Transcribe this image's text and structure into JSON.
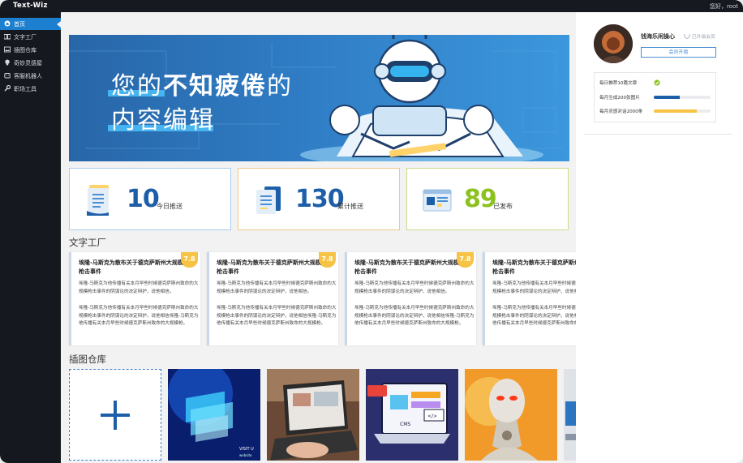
{
  "app": {
    "name": "Text-Wiz"
  },
  "topbar": {
    "greeting": "您好，root"
  },
  "sidebar": {
    "items": [
      {
        "label": "首页",
        "icon": "home-icon",
        "active": true
      },
      {
        "label": "文字工厂",
        "icon": "book-icon"
      },
      {
        "label": "插图仓库",
        "icon": "image-icon"
      },
      {
        "label": "奇妙灵感屋",
        "icon": "bulb-icon"
      },
      {
        "label": "客服机器人",
        "icon": "robot-icon"
      },
      {
        "label": "职场工具",
        "icon": "wrench-icon"
      }
    ]
  },
  "banner": {
    "line1_pre": "您的",
    "line1_bold": "不知疲倦",
    "line1_post": "的",
    "line2": "内容编辑"
  },
  "stats": [
    {
      "value": "10",
      "label": "今日推送",
      "color": "#1c5fa8",
      "icon": "document-icon"
    },
    {
      "value": "130",
      "label": "累计推送",
      "color": "#1c5fa8",
      "icon": "files-icon"
    },
    {
      "value": "89",
      "label": "已发布",
      "color": "#8cc21f",
      "icon": "browser-window-icon"
    }
  ],
  "text_factory": {
    "title": "文字工厂",
    "articles": [
      {
        "title": "埃隆-马斯克为散布关于德克萨斯州大规模枪击事件",
        "score": "7.8",
        "p1": "埃隆-马斯克为他传播有关本月早些时候德克萨斯州致命的大规模枪击事件的阴谋论的决定辩护，说他相信。",
        "p2": "埃隆-马斯克为他传播有关本月早些时候德克萨斯州致命的大规模枪击事件的阴谋论的决定辩护，说他相信埃隆-马斯克为他传播有关本月早些时候德克萨斯州致命的大规模枪。"
      },
      {
        "title": "埃隆-马斯克为散布关于德克萨斯州大规模枪击事件",
        "score": "7.8",
        "p1": "埃隆-马斯克为他传播有关本月早些时候德克萨斯州致命的大规模枪击事件的阴谋论的决定辩护，说他相信。",
        "p2": "埃隆-马斯克为他传播有关本月早些时候德克萨斯州致命的大规模枪击事件的阴谋论的决定辩护，说他相信埃隆-马斯克为他传播有关本月早些时候德克萨斯州致命的大规模枪。"
      },
      {
        "title": "埃隆-马斯克为散布关于德克萨斯州大规模枪击事件",
        "score": "7.8",
        "p1": "埃隆-马斯克为他传播有关本月早些时候德克萨斯州致命的大规模枪击事件的阴谋论的决定辩护，说他相信。",
        "p2": "埃隆-马斯克为他传播有关本月早些时候德克萨斯州致命的大规模枪击事件的阴谋论的决定辩护，说他相信埃隆-马斯克为他传播有关本月早些时候德克萨斯州致命的大规模枪。"
      },
      {
        "title": "埃隆-马斯克为散布关于德克萨斯州大规模枪击事件",
        "score": "",
        "p1": "埃隆-马斯克为他传播有关本月早些时候德克萨斯州致命的大规模枪击事件的阴谋论的决定辩护，说他相信。",
        "p2": "埃隆-马斯克为他传播有关本月早些时候德克萨斯州致命的大规模枪击事件的阴谋论的决定辩护，说他相信埃隆-马斯克为他传播有关本月早些时候德克萨斯州致命的大规模枪。"
      }
    ]
  },
  "gallery": {
    "title": "插图仓库",
    "add_icon": "plus-icon",
    "thumb1_caption": "VISIT U",
    "thumb1_sub": "website",
    "thumb3_cms": "CMS",
    "thumb3_code": "</>"
  },
  "profile": {
    "username": "钱海乐闲操心",
    "badge": "已升级会员",
    "upgrade_label": "会员升级",
    "tasks": [
      {
        "label": "每日推荐10篇文章",
        "done": true
      },
      {
        "label": "每月生成200张图片",
        "progress": 0.45,
        "color": "#1c5fa8"
      },
      {
        "label": "每月灵感对话2000条",
        "progress": 0.75,
        "color": "#f6c344"
      }
    ]
  }
}
